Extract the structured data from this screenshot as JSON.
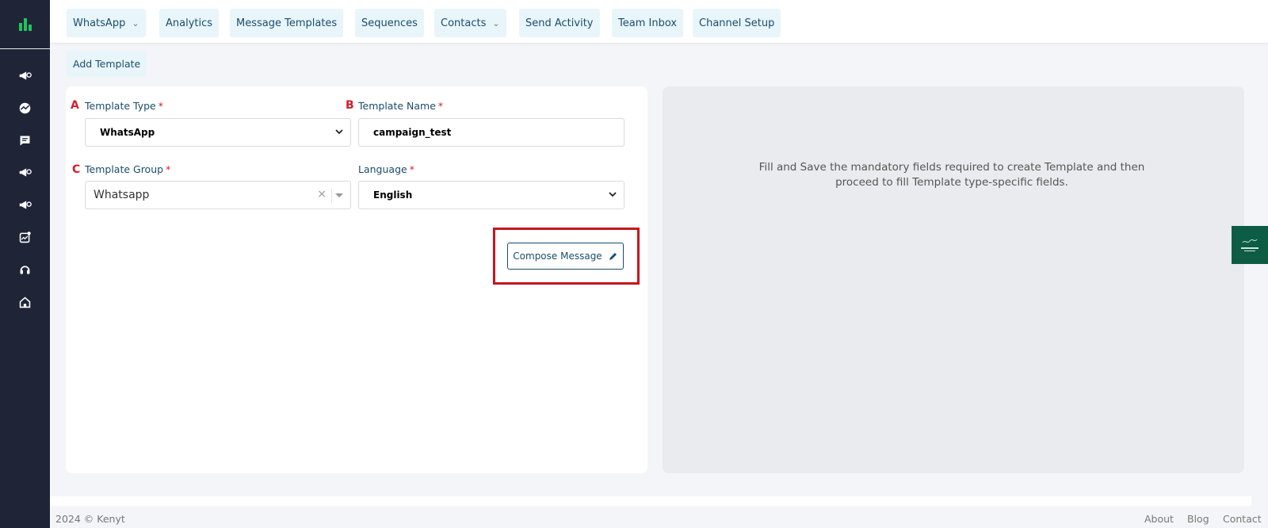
{
  "nav": {
    "tabs": [
      {
        "label": "WhatsApp",
        "has_dropdown": true
      },
      {
        "label": "Analytics",
        "has_dropdown": false
      },
      {
        "label": "Message Templates",
        "has_dropdown": false
      },
      {
        "label": "Sequences",
        "has_dropdown": false
      },
      {
        "label": "Contacts",
        "has_dropdown": true
      },
      {
        "label": "Send Activity",
        "has_dropdown": false
      },
      {
        "label": "Team Inbox",
        "has_dropdown": false
      },
      {
        "label": "Channel Setup",
        "has_dropdown": false
      }
    ],
    "sub_tab": "Add Template"
  },
  "sidebar": {
    "logo_icon": "bar-chart-icon",
    "items": [
      {
        "icon": "megaphone-icon"
      },
      {
        "icon": "chart-circle-icon"
      },
      {
        "icon": "chat-icon"
      },
      {
        "icon": "megaphone-icon"
      },
      {
        "icon": "megaphone-icon"
      },
      {
        "icon": "analytics-icon"
      },
      {
        "icon": "headset-icon"
      },
      {
        "icon": "home-icon"
      }
    ]
  },
  "form": {
    "markers": {
      "a": "A",
      "b": "B",
      "c": "C"
    },
    "template_type": {
      "label": "Template Type",
      "value": "WhatsApp"
    },
    "template_name": {
      "label": "Template Name",
      "value": "campaign_test"
    },
    "template_group": {
      "label": "Template Group",
      "value": "Whatsapp"
    },
    "language": {
      "label": "Language",
      "value": "English"
    },
    "required_mark": "*",
    "clear_glyph": "×",
    "compose_button": "Compose Message"
  },
  "preview": {
    "message_line1": "Fill and Save the mandatory fields required to create Template and then",
    "message_line2": "proceed to fill Template type-specific fields."
  },
  "footer": {
    "copyright": "2024 © Kenyt",
    "links": [
      "About",
      "Blog",
      "Contact"
    ]
  },
  "colors": {
    "sidebar_bg": "#1f2537",
    "accent_green": "#22c35e",
    "tab_bg": "#e8f6fb",
    "tab_text": "#1b4c6b",
    "required_red": "#d21e2b",
    "highlight_red": "#c4161f"
  }
}
